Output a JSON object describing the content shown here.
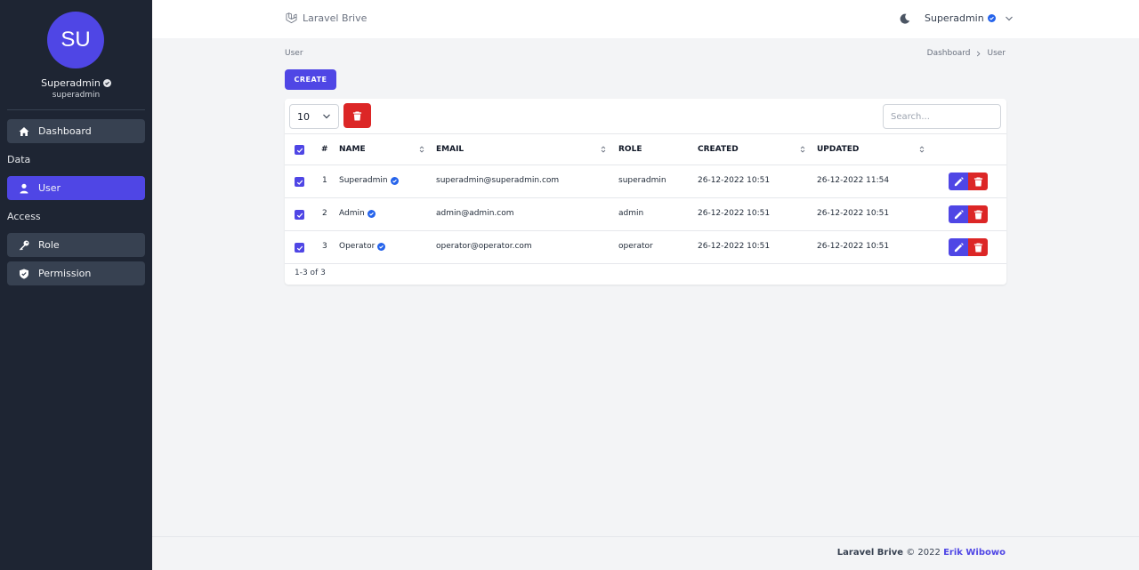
{
  "sidebar": {
    "avatar_initials": "SU",
    "user_name": "Superadmin",
    "user_handle": "superadmin",
    "items": [
      {
        "label": "Dashboard"
      },
      {
        "label": "User"
      },
      {
        "label": "Role"
      },
      {
        "label": "Permission"
      }
    ],
    "groups": {
      "data": "Data",
      "access": "Access"
    }
  },
  "header": {
    "brand": "Laravel Brive",
    "user_menu": "Superadmin"
  },
  "page": {
    "title": "User",
    "breadcrumb": [
      "Dashboard",
      "User"
    ],
    "create_label": "CREATE"
  },
  "table": {
    "per_page": "10",
    "search_placeholder": "Search...",
    "columns": [
      "#",
      "NAME",
      "EMAIL",
      "ROLE",
      "CREATED",
      "UPDATED"
    ],
    "rows": [
      {
        "num": "1",
        "name": "Superadmin",
        "email": "superadmin@superadmin.com",
        "role": "superadmin",
        "created": "26-12-2022 10:51",
        "updated": "26-12-2022 11:54"
      },
      {
        "num": "2",
        "name": "Admin",
        "email": "admin@admin.com",
        "role": "admin",
        "created": "26-12-2022 10:51",
        "updated": "26-12-2022 10:51"
      },
      {
        "num": "3",
        "name": "Operator",
        "email": "operator@operator.com",
        "role": "operator",
        "created": "26-12-2022 10:51",
        "updated": "26-12-2022 10:51"
      }
    ],
    "pagination": "1-3 of 3"
  },
  "footer": {
    "app": "Laravel Brive",
    "copyright": "© 2022",
    "author": "Erik Wibowo"
  },
  "colors": {
    "primary": "#4f46e5",
    "danger": "#dc2626",
    "sidebar_bg": "#1e2533",
    "verified": "#2563eb"
  }
}
